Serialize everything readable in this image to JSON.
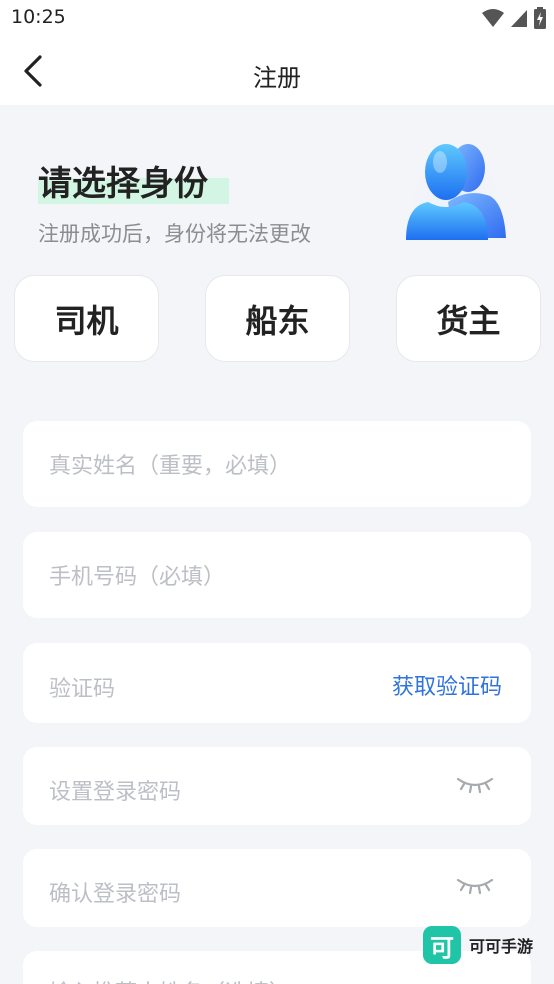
{
  "status_bar": {
    "time": "10:25"
  },
  "navbar": {
    "title": "注册"
  },
  "hero": {
    "title": "请选择身份",
    "subtitle": "注册成功后，身份将无法更改"
  },
  "roles": [
    {
      "label": "司机"
    },
    {
      "label": "船东"
    },
    {
      "label": "货主"
    }
  ],
  "form": {
    "name_placeholder": "真实姓名（重要，必填）",
    "phone_placeholder": "手机号码（必填）",
    "code_placeholder": "验证码",
    "get_code_label": "获取验证码",
    "password_placeholder": "设置登录密码",
    "confirm_placeholder": "确认登录密码",
    "referrer_placeholder": "输入推荐人姓名（选填）"
  },
  "watermark": {
    "logo": "可",
    "text": "可可手游"
  },
  "colors": {
    "accent": "#2f73dd",
    "highlight": "#d3f6e4",
    "background": "#f4f5f8"
  }
}
